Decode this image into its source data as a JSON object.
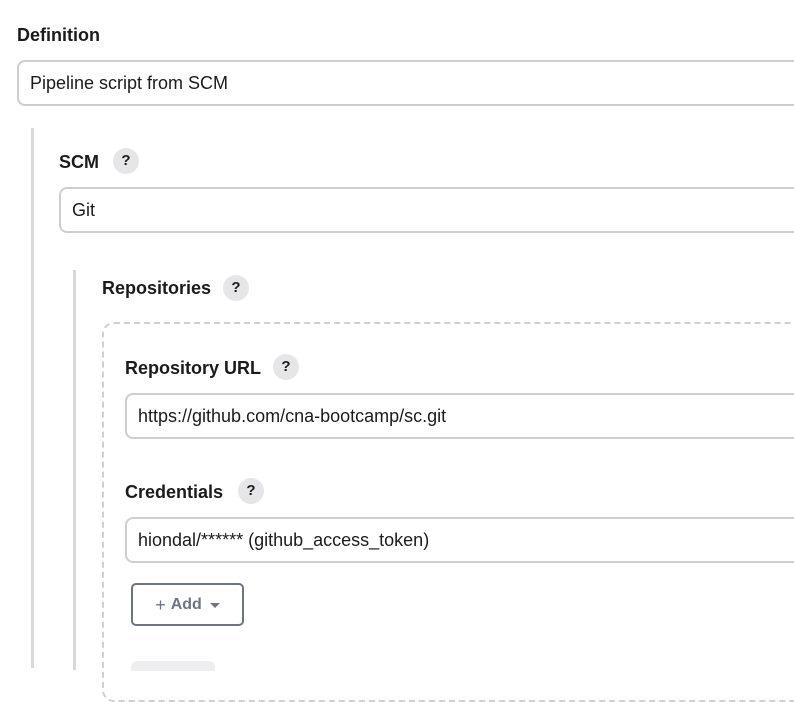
{
  "definition": {
    "label": "Definition",
    "value": "Pipeline script from SCM"
  },
  "scm": {
    "label": "SCM",
    "help": "?",
    "value": "Git"
  },
  "repositories": {
    "label": "Repositories",
    "help": "?",
    "repository_url": {
      "label": "Repository URL",
      "help": "?",
      "value": "https://github.com/cna-bootcamp/sc.git"
    },
    "credentials": {
      "label": "Credentials",
      "help": "?",
      "value": "hiondal/****** (github_access_token)"
    },
    "add_button": {
      "plus": "+",
      "label": "Add"
    }
  },
  "colors": {
    "help_bg": "#e6e6e9",
    "border": "#cdcdd2",
    "section_bar": "#d9d9dd",
    "button_text": "#6e7580"
  }
}
